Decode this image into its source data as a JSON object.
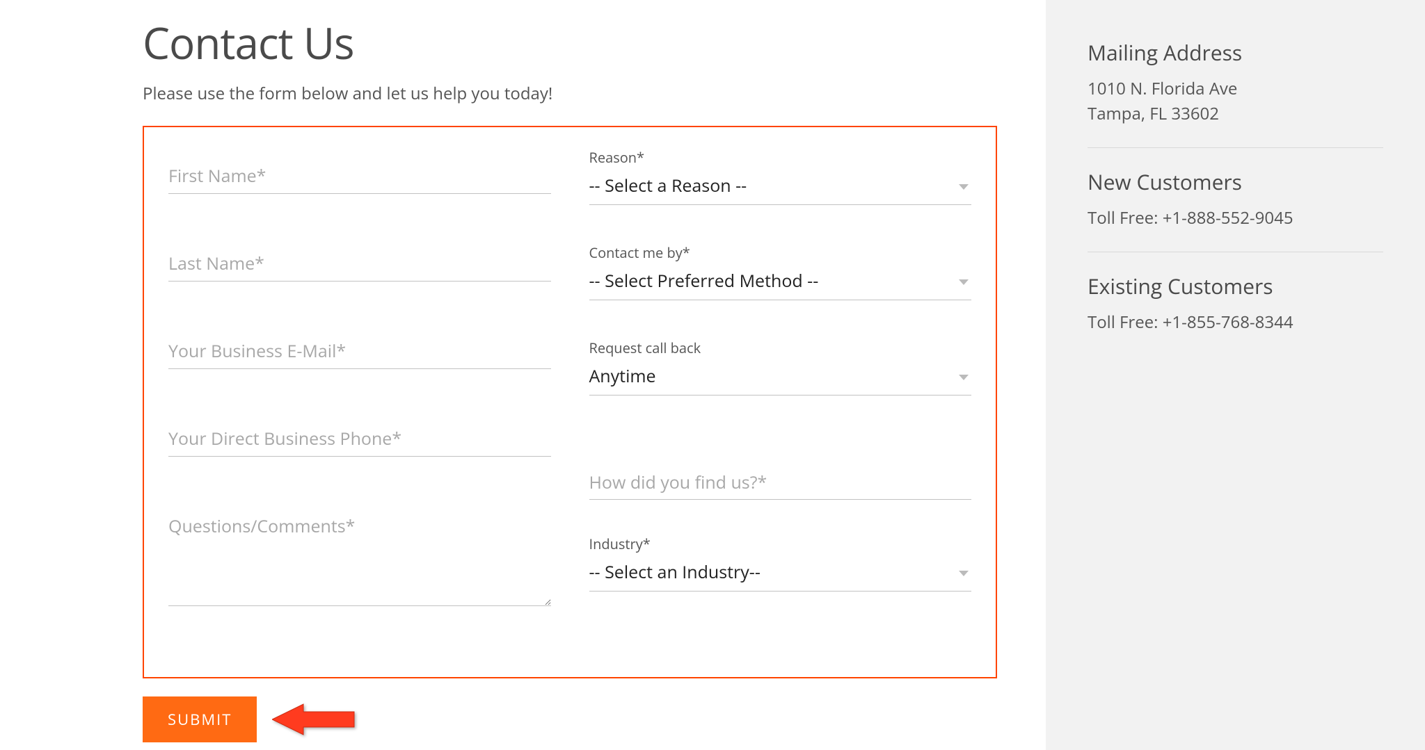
{
  "header": {
    "title": "Contact Us",
    "subtitle": "Please use the form below and let us help you today!"
  },
  "form": {
    "left": {
      "first_name_placeholder": "First Name*",
      "last_name_placeholder": "Last Name*",
      "email_placeholder": "Your Business E-Mail*",
      "phone_placeholder": "Your Direct Business Phone*",
      "comments_placeholder": "Questions/Comments*"
    },
    "right": {
      "reason_label": "Reason*",
      "reason_value": "-- Select a Reason --",
      "contact_by_label": "Contact me by*",
      "contact_by_value": "-- Select Preferred Method --",
      "callback_label": "Request call back",
      "callback_value": "Anytime",
      "find_us_placeholder": "How did you find us?*",
      "industry_label": "Industry*",
      "industry_value": "-- Select an Industry--"
    },
    "submit_label": "SUBMIT"
  },
  "sidebar": {
    "mailing": {
      "heading": "Mailing Address",
      "line1": "1010 N. Florida Ave",
      "line2": "Tampa, FL 33602"
    },
    "new_customers": {
      "heading": "New Customers",
      "text": "Toll Free: +1-888-552-9045"
    },
    "existing_customers": {
      "heading": "Existing Customers",
      "text": "Toll Free: +1-855-768-8344"
    }
  },
  "annotation": {
    "arrow_color": "#ff3b1f"
  }
}
